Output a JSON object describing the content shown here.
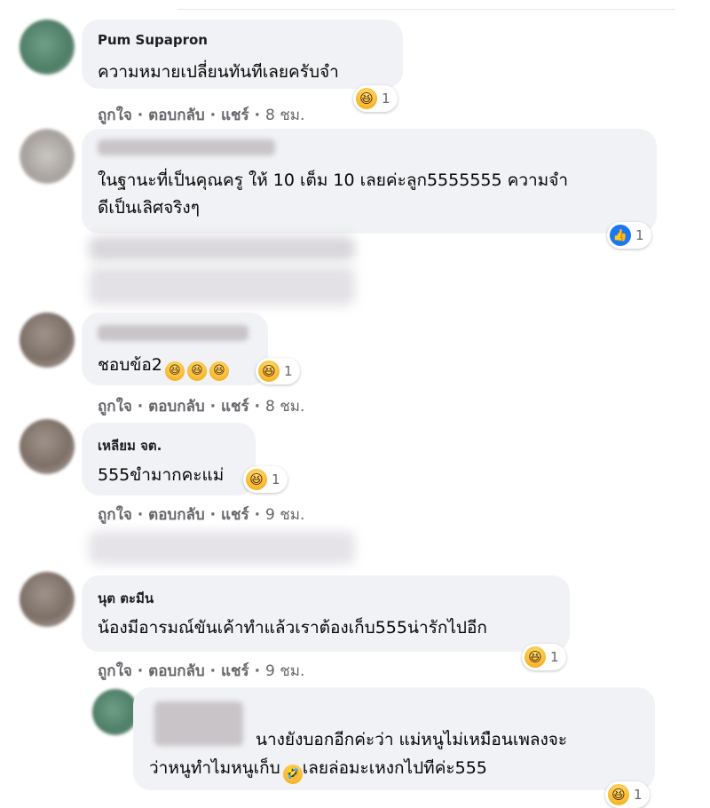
{
  "actions": {
    "like": "ถูกใจ",
    "reply": "ตอบกลับ",
    "share": "แชร์",
    "sep": "·"
  },
  "comments": [
    {
      "name": "Pum Supapron",
      "text": "ความหมายเปลี่ยนทันทีเลยครับจำ",
      "time": "8 ชม.",
      "reaction_count": "1",
      "reaction": "haha"
    },
    {
      "text_line1": "ในฐานะที่เป็นคุณครู ให้ 10 เต็ม 10 เลยค่ะลูก5555555 ความจำ",
      "text_line2": "ดีเป็นเลิศจริงๆ",
      "reaction_count": "1",
      "reaction": "like"
    },
    {
      "text": "ชอบข้อ2",
      "time": "8 ชม.",
      "reaction_count": "1",
      "reaction": "haha"
    },
    {
      "name": "เหลียม จต.",
      "text": "555ขำมากคะแม่",
      "time": "9 ชม.",
      "reaction_count": "1",
      "reaction": "haha"
    },
    {
      "name": "นุต ตะมีน",
      "text": "น้องมีอารมณ์ขันเค้าทำแล้วเราต้องเก็บ555น่ารักไปอีก",
      "time": "9 ชม.",
      "reaction_count": "1",
      "reaction": "haha"
    },
    {
      "text_line1": "นางยังบอกอีกค่ะว่า แม่หนูไม่เหมือนเพลงจะ",
      "text_line2": "ว่าหนูทำไมหนูเก็บ",
      "text_line2b": "เลยล่อมะเหงกไปทีค่ะ555",
      "reaction_count": "1",
      "reaction": "haha"
    }
  ],
  "icons": {
    "haha": "grinning-squinting-face",
    "like": "thumbs-up",
    "rofl": "rolling-on-floor-laughing"
  }
}
